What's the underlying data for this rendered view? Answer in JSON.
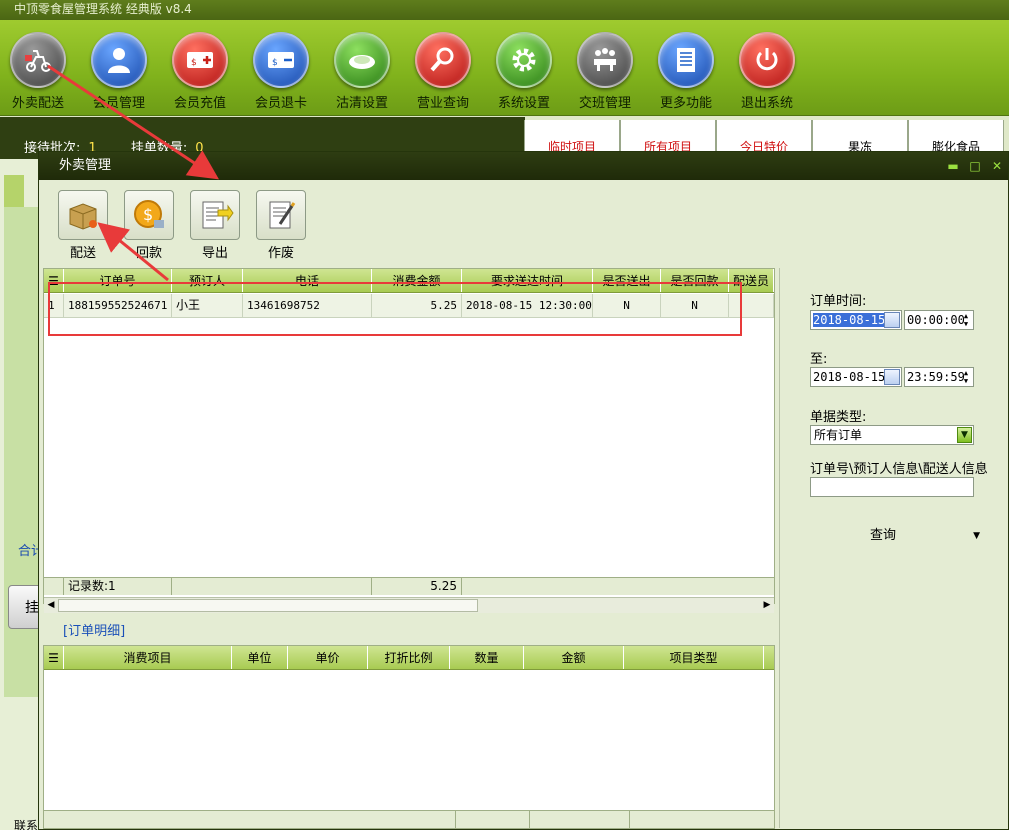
{
  "app": {
    "title": "中顶零食屋管理系统 经典版 v8.4"
  },
  "toolbar": {
    "items": [
      {
        "label": "外卖配送",
        "icon": "scooter-icon",
        "color": "#505050"
      },
      {
        "label": "会员管理",
        "icon": "user-icon",
        "color": "#1c5fc8"
      },
      {
        "label": "会员充值",
        "icon": "card-plus-icon",
        "color": "#c82018"
      },
      {
        "label": "会员退卡",
        "icon": "card-minus-icon",
        "color": "#1c5fc8"
      },
      {
        "label": "沽清设置",
        "icon": "plate-icon",
        "color": "#3a9a20"
      },
      {
        "label": "营业查询",
        "icon": "magnifier-icon",
        "color": "#c82018"
      },
      {
        "label": "系统设置",
        "icon": "gear-icon",
        "color": "#3a9a20"
      },
      {
        "label": "交班管理",
        "icon": "meeting-icon",
        "color": "#505050"
      },
      {
        "label": "更多功能",
        "icon": "list-icon",
        "color": "#1c5fc8"
      },
      {
        "label": "退出系统",
        "icon": "power-icon",
        "color": "#c82018"
      }
    ]
  },
  "background": {
    "waiting_batches_label": "接待批次:",
    "waiting_batches_value": "1",
    "pending_qty_label": "挂单数量:",
    "pending_qty_value": "0",
    "category_tabs": [
      {
        "label": "临时项目",
        "color": "#d01010"
      },
      {
        "label": "所有项目",
        "color": "#d01010"
      },
      {
        "label": "今日特价",
        "color": "#d01010"
      },
      {
        "label": "果冻",
        "color": "#000000"
      },
      {
        "label": "膨化食品",
        "color": "#000000"
      }
    ],
    "total_label": "合计",
    "pending_button_label": "挂",
    "contact_label": "联系"
  },
  "dialog": {
    "title": "外卖管理",
    "toolbar": [
      {
        "label": "配送",
        "icon": "box-delivery-icon"
      },
      {
        "label": "回款",
        "icon": "coin-icon"
      },
      {
        "label": "导出",
        "icon": "export-icon"
      },
      {
        "label": "作废",
        "icon": "void-icon"
      }
    ],
    "orders": {
      "columns": [
        "订单号",
        "预订人",
        "电话",
        "消费金额",
        "要求送达时间",
        "是否送出",
        "是否回款",
        "配送员"
      ],
      "rows": [
        {
          "index": "1",
          "order_no": "188159552524671",
          "booker": "小王",
          "phone": "13461698752",
          "amount": "5.25",
          "deliver_time": "2018-08-15 12:30:00",
          "delivered": "N",
          "paid": "N",
          "courier": ""
        }
      ],
      "record_count_label": "记录数:1",
      "total_amount": "5.25"
    },
    "detail": {
      "title": "[订单明细]",
      "columns": [
        "消费项目",
        "单位",
        "单价",
        "打折比例",
        "数量",
        "金额",
        "项目类型"
      ]
    },
    "filters": {
      "order_time_label": "订单时间:",
      "from_date": "2018-08-15",
      "from_time": "00:00:00",
      "to_label": "至:",
      "to_date": "2018-08-15",
      "to_time": "23:59:59",
      "order_type_label": "单据类型:",
      "order_type_value": "所有订单",
      "search_label": "订单号\\预订人信息\\配送人信息",
      "search_value": "",
      "query_label": "查询"
    }
  },
  "colors": {
    "highlight": "#e83a3a",
    "accent_green": "#8fbf24"
  }
}
